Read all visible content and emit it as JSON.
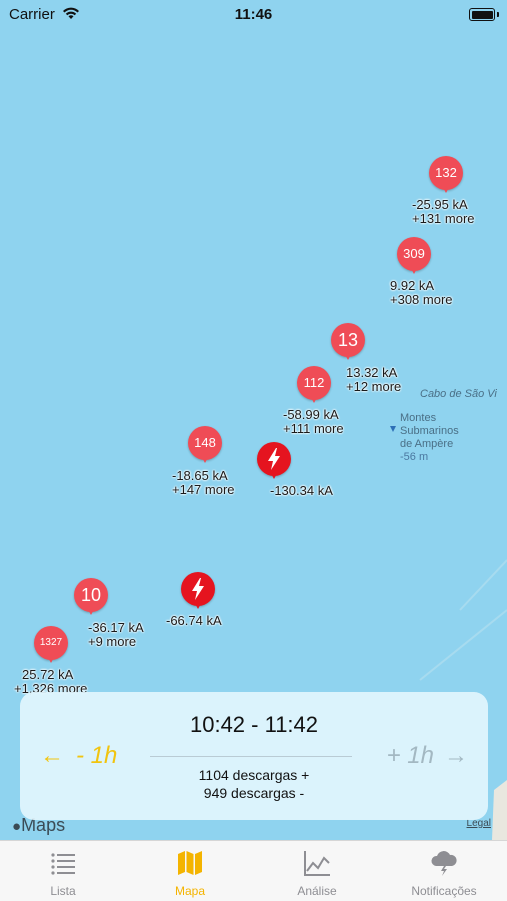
{
  "status_bar": {
    "carrier": "Carrier",
    "time": "11:46"
  },
  "map": {
    "place_labels": {
      "cabo": "Cabo de São Vi",
      "montes_line1": "Montes",
      "montes_line2": "Submarinos",
      "montes_line3": "de Ampère",
      "depth": "-56 m"
    },
    "clusters": [
      {
        "count": "132",
        "value": "-25.95 kA",
        "more": "+131 more"
      },
      {
        "count": "309",
        "value": "9.92 kA",
        "more": "+308 more"
      },
      {
        "count": "13",
        "value": "13.32 kA",
        "more": "+12 more"
      },
      {
        "count": "112",
        "value": "-58.99 kA",
        "more": "+111 more"
      },
      {
        "count": "148",
        "value": "-18.65 kA",
        "more": "+147 more"
      },
      {
        "count": "10",
        "value": "-36.17 kA",
        "more": "+9 more"
      },
      {
        "count": "1327",
        "value": "25.72 kA",
        "more": "+1,326 more"
      }
    ],
    "strikes": [
      {
        "value": "-130.34 kA"
      },
      {
        "value": "-66.74 kA"
      }
    ],
    "maps_logo": "Maps",
    "legal": "Legal",
    "colors": {
      "pin": "#ef4c56",
      "strike": "#e5141f",
      "water": "#8fd3ef"
    }
  },
  "panel": {
    "range": "10:42 - 11:42",
    "prev_label": "- 1h",
    "next_label": "+ 1h",
    "positive_count": "1104 descargas +",
    "negative_count": "949 descargas -"
  },
  "tabs": [
    {
      "label": "Lista",
      "icon": "list-icon"
    },
    {
      "label": "Mapa",
      "icon": "map-icon",
      "active": true
    },
    {
      "label": "Análise",
      "icon": "chart-icon"
    },
    {
      "label": "Notificações",
      "icon": "storm-cloud-icon"
    }
  ]
}
